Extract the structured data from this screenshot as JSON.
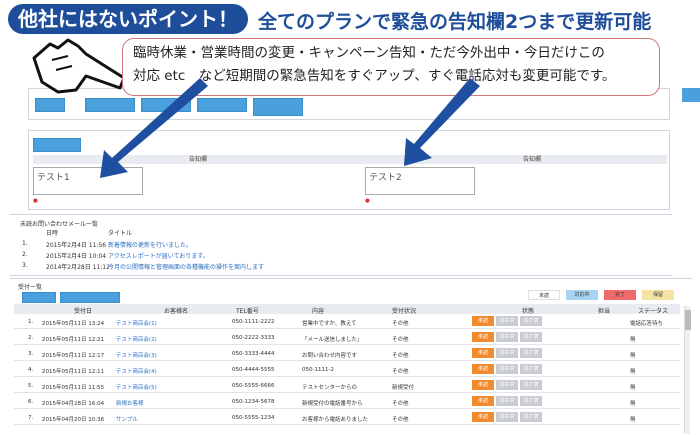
{
  "banner": {
    "badge": "他社にはないポイント！",
    "headline": "全てのプランで緊急の告知欄2つまで更新可能",
    "bubble_line1": "臨時休業・営業時間の変更・キャンペーン告知・ただ今外出中・今日だけこの",
    "bubble_line2": "対応 etc　など短期間の緊急告知をすぐアップ、すぐ電話応対も変更可能です。"
  },
  "colors": {
    "brand": "#1e4e9a",
    "button": "#4aa0dd",
    "orange": "#f08a2a",
    "red_text": "#d33333"
  },
  "notice": {
    "col_header_left": "告知欄",
    "col_header_right": "告知欄",
    "text1": "テスト1",
    "text2": "テスト2"
  },
  "mail_list": {
    "title": "未読お問い合わせメール一覧",
    "col_date": "日時",
    "col_title": "タイトル",
    "rows": [
      {
        "num": "1.",
        "date": "2015年2月4日 11:56",
        "title": "新着情報の更新を行いました。"
      },
      {
        "num": "2.",
        "date": "2015年2月4日 10:04",
        "title": "アクセスレポートが届いております。"
      },
      {
        "num": "3.",
        "date": "2014年2月28日 11:12",
        "title": "今月の公開情報と管理画面の各種機能の操作を案内します"
      }
    ]
  },
  "call_list": {
    "title": "受付一覧",
    "legend": [
      "未読",
      "対応中",
      "完了",
      "保留"
    ],
    "headers": [
      "受付日",
      "お客様名",
      "TEL番号",
      "内容",
      "受付状況",
      "状態",
      "担当",
      "ステータス"
    ],
    "rows": [
      {
        "num": "1.",
        "date": "2015年05月11日 13:24",
        "name": "テスト商店会(1)",
        "tel": "050-1111-2222",
        "body": "営業中ですか、教えて",
        "kind": "その他",
        "staff": "",
        "status": "電話応答待ち"
      },
      {
        "num": "2.",
        "date": "2015年05月11日 12:21",
        "name": "テスト商店会(2)",
        "tel": "050-2222-3333",
        "body": "「メール送信しました」",
        "kind": "その他",
        "staff": "",
        "status": "無"
      },
      {
        "num": "3.",
        "date": "2015年05月11日 12:17",
        "name": "テスト商店会(3)",
        "tel": "050-3333-4444",
        "body": "お問い合わせ内容です",
        "kind": "その他",
        "staff": "",
        "status": "無"
      },
      {
        "num": "4.",
        "date": "2015年05月11日 12:11",
        "name": "テスト商店会(4)",
        "tel": "050-4444-5555",
        "body": "050-1111-2",
        "kind": "その他",
        "staff": "",
        "status": "無"
      },
      {
        "num": "5.",
        "date": "2015年05月11日 11:55",
        "name": "テスト商店会(5)",
        "tel": "050-5555-6666",
        "body": "テストセンターからの",
        "kind": "新規受付",
        "staff": "",
        "status": "無"
      },
      {
        "num": "6.",
        "date": "2015年04月28日 16:04",
        "name": "新規お客様",
        "tel": "050-1234-5678",
        "body": "新規受付の電話番号から",
        "kind": "その他",
        "staff": "",
        "status": "無"
      },
      {
        "num": "7.",
        "date": "2015年04月20日 10:36",
        "name": "サンプル",
        "tel": "050-5555-1234",
        "body": "お客様から電話ありました",
        "kind": "その他",
        "staff": "",
        "status": "無"
      }
    ],
    "action_buttons": [
      "未読",
      "対応中",
      "完了済"
    ]
  }
}
